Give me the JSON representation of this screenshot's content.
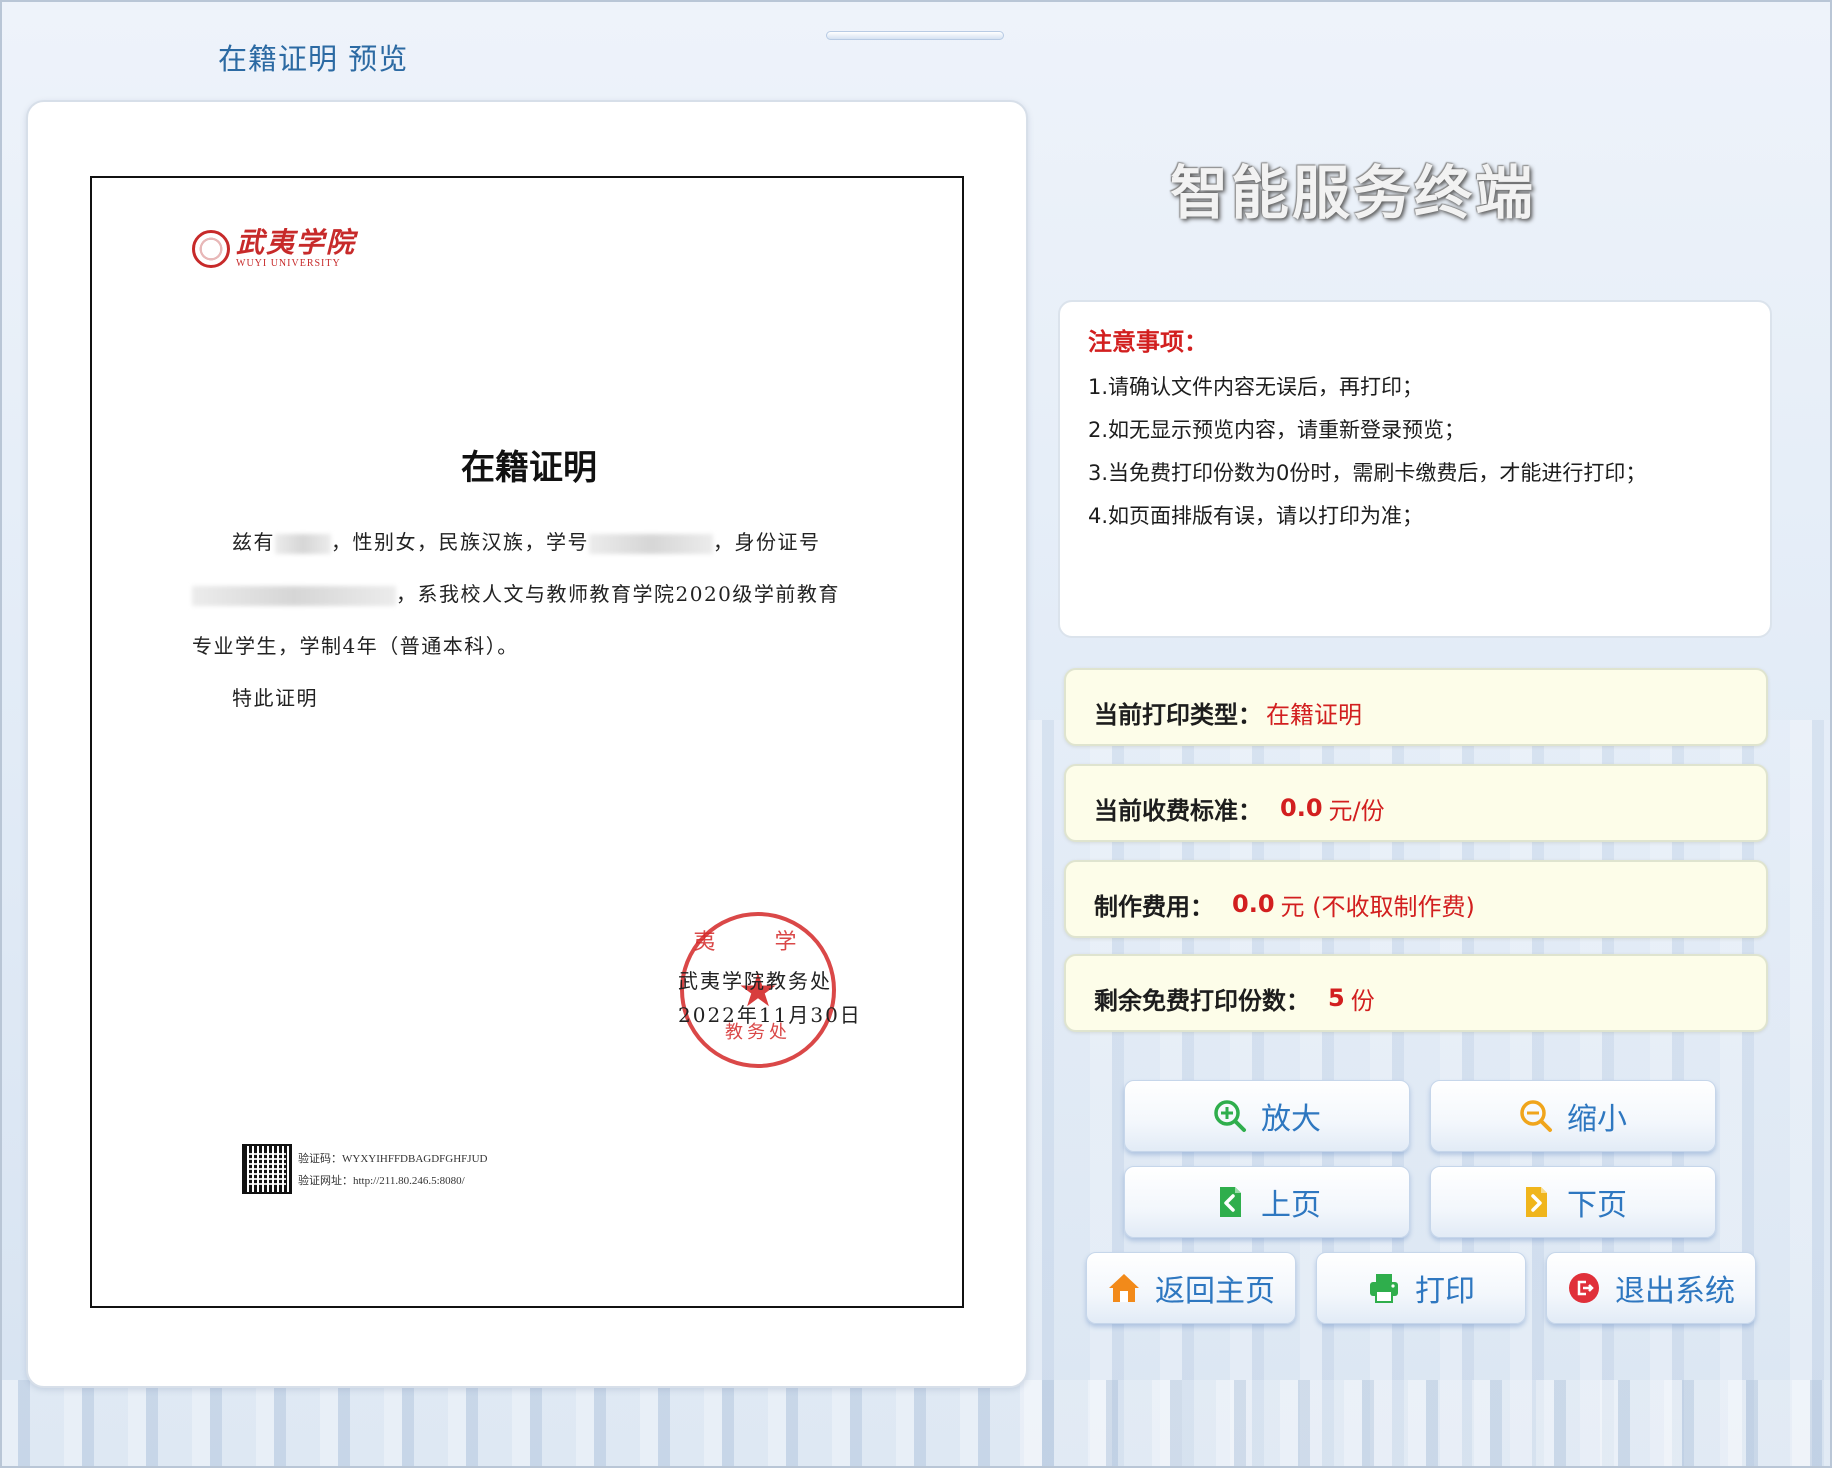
{
  "header": {
    "title": "在籍证明 预览"
  },
  "document": {
    "logo_cn": "武夷学院",
    "logo_en": "WUYI UNIVERSITY",
    "title": "在籍证明",
    "line1_a": "兹有",
    "line1_b": "，性别女，民族汉族，学号",
    "line1_c": "，身份证号",
    "line2_b": "，系我校人文与教师教育学院2020级学前教育",
    "line3": "专业学生，学制4年（普通本科）。",
    "line4": "特此证明",
    "stamp_top": "夷 学",
    "stamp_bottom": "教务处",
    "issuer": "武夷学院教务处",
    "date": "2022年11月30日",
    "verify_code": "验证码：WYXYIHFFDBAGDFGHFJUD",
    "verify_url": "验证网址：http://211.80.246.5:8080/"
  },
  "terminal_title": "智能服务终端",
  "notice": {
    "heading": "注意事项：",
    "items": [
      "1.请确认文件内容无误后，再打印；",
      "2.如无显示预览内容，请重新登录预览；",
      "3.当免费打印份数为0份时，需刷卡缴费后，才能进行打印；",
      "4.如页面排版有误，请以打印为准；"
    ]
  },
  "info": {
    "print_type_label": "当前打印类型：",
    "print_type_value": "在籍证明",
    "fee_label": "当前收费标准：",
    "fee_value": "0.0",
    "fee_unit": "元/份",
    "making_label": "制作费用：",
    "making_value": "0.0",
    "making_unit": "元 (不收取制作费)",
    "free_label": "剩余免费打印份数：",
    "free_value": "5",
    "free_unit": "份"
  },
  "buttons": {
    "zoom_in": "放大",
    "zoom_out": "缩小",
    "prev_page": "上页",
    "next_page": "下页",
    "home": "返回主页",
    "print": "打印",
    "exit": "退出系统"
  },
  "colors": {
    "accent_blue": "#2e77c0",
    "alert_red": "#d21f1f",
    "zoom_green": "#2fae4c",
    "zoom_out_orange": "#f0a51c",
    "home_orange": "#f28a1a",
    "exit_red": "#e0303a"
  }
}
